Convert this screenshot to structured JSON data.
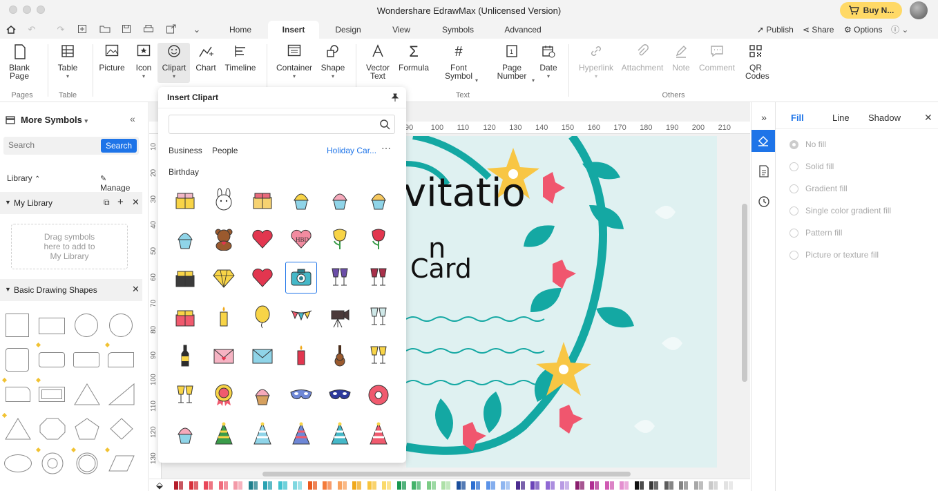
{
  "window": {
    "title": "Wondershare EdrawMax (Unlicensed Version)",
    "buy_label": "Buy N..."
  },
  "menu": {
    "tabs": [
      "Home",
      "Insert",
      "Design",
      "View",
      "Symbols",
      "Advanced"
    ],
    "active_tab": "Insert",
    "publish": "Publish",
    "share": "Share",
    "options": "Options"
  },
  "ribbon": {
    "blank_page": "Blank Page",
    "table": "Table",
    "picture": "Picture",
    "icon": "Icon",
    "clipart": "Clipart",
    "chart": "Chart",
    "timeline": "Timeline",
    "container": "Container",
    "shape": "Shape",
    "vector_text": "Vector Text",
    "formula": "Formula",
    "font_symbol": "Font Symbol",
    "page_number": "Page Number",
    "date": "Date",
    "hyperlink": "Hyperlink",
    "attachment": "Attachment",
    "note": "Note",
    "comment": "Comment",
    "qr_codes": "QR Codes",
    "groups": {
      "pages": "Pages",
      "table": "Table",
      "text": "Text",
      "others": "Others"
    }
  },
  "left_panel": {
    "title": "More Symbols",
    "search_placeholder": "Search",
    "search_button": "Search",
    "library_label": "Library",
    "manage_label": "Manage",
    "my_library": "My Library",
    "drop_hint_1": "Drag symbols",
    "drop_hint_2": "here to add to",
    "drop_hint_3": "My Library",
    "basic_shapes": "Basic Drawing Shapes"
  },
  "clipart_popup": {
    "title": "Insert Clipart",
    "categories": [
      "Business",
      "People",
      "Holiday Car..."
    ],
    "subcategory": "Birthday",
    "items": [
      "present-icon",
      "bunny-icon",
      "cake-slice-icon",
      "cupcake-icon",
      "pink-cupcake-icon",
      "cream-cupcake-icon",
      "heart-cupcake-icon",
      "teddy-bear-icon",
      "hbd-heart-icon",
      "heart-balloons-icon",
      "tulip-icon",
      "rose-icon",
      "birthday-cake-icon",
      "diamond-icon",
      "heart-icon",
      "camera-icon",
      "wine-toast-icon",
      "champagne-toast-icon",
      "gift-box-icon",
      "candle-icon",
      "balloon-icon",
      "bunting-icon",
      "video-camera-icon",
      "glasses-toast-icon",
      "wine-bottle-icon",
      "love-letter-icon",
      "envelope-icon",
      "candelabra-icon",
      "guitar-icon",
      "cocktail-icon",
      "martini-icon",
      "award-ribbon-icon",
      "ice-cream-icon",
      "party-mask-icon",
      "blue-mask-icon",
      "donut-icon",
      "sundae-icon",
      "green-party-hat-icon",
      "blue-party-hat-icon",
      "purple-party-hat-icon",
      "teal-party-hat-icon",
      "red-party-hat-icon"
    ],
    "hbd_text": "HBD"
  },
  "canvas": {
    "ruler_top": [
      "90",
      "100",
      "110",
      "120",
      "130",
      "140",
      "150",
      "160",
      "170",
      "180",
      "190",
      "200",
      "210"
    ],
    "ruler_left": [
      "10",
      "20",
      "30",
      "40",
      "50",
      "60",
      "70",
      "80",
      "90",
      "100",
      "110",
      "120",
      "130"
    ],
    "title_part1": "vitatio",
    "title_part2": "n",
    "subtitle": "Card"
  },
  "right_panel": {
    "tabs": [
      "Fill",
      "Line",
      "Shadow"
    ],
    "active": "Fill",
    "fill_options": [
      "No fill",
      "Solid fill",
      "Gradient fill",
      "Single color gradient fill",
      "Pattern fill",
      "Picture or texture fill"
    ]
  },
  "palette": [
    "#b51e2b",
    "#d6303b",
    "#e8485a",
    "#f06b7c",
    "#f39aa8",
    "#1f7f8c",
    "#2aa3b3",
    "#3fc1cf",
    "#7fd7e0",
    "#e95a1e",
    "#f47b3a",
    "#f8a15e",
    "#f0a91b",
    "#f7c43e",
    "#fad96a",
    "#1a9850",
    "#44b36a",
    "#7ccc86",
    "#aee0a8",
    "#1b4f9c",
    "#2e6fd1",
    "#5b93e8",
    "#8fb6f0",
    "#4c2c90",
    "#6b44b8",
    "#9069d4",
    "#b89be3",
    "#8a1e6e",
    "#b02e92",
    "#d05ab3",
    "#e48fd0",
    "#111111",
    "#3a3a3a",
    "#5e5e5e",
    "#848484",
    "#a8a8a8",
    "#c9c9c9",
    "#e2e2e2"
  ]
}
